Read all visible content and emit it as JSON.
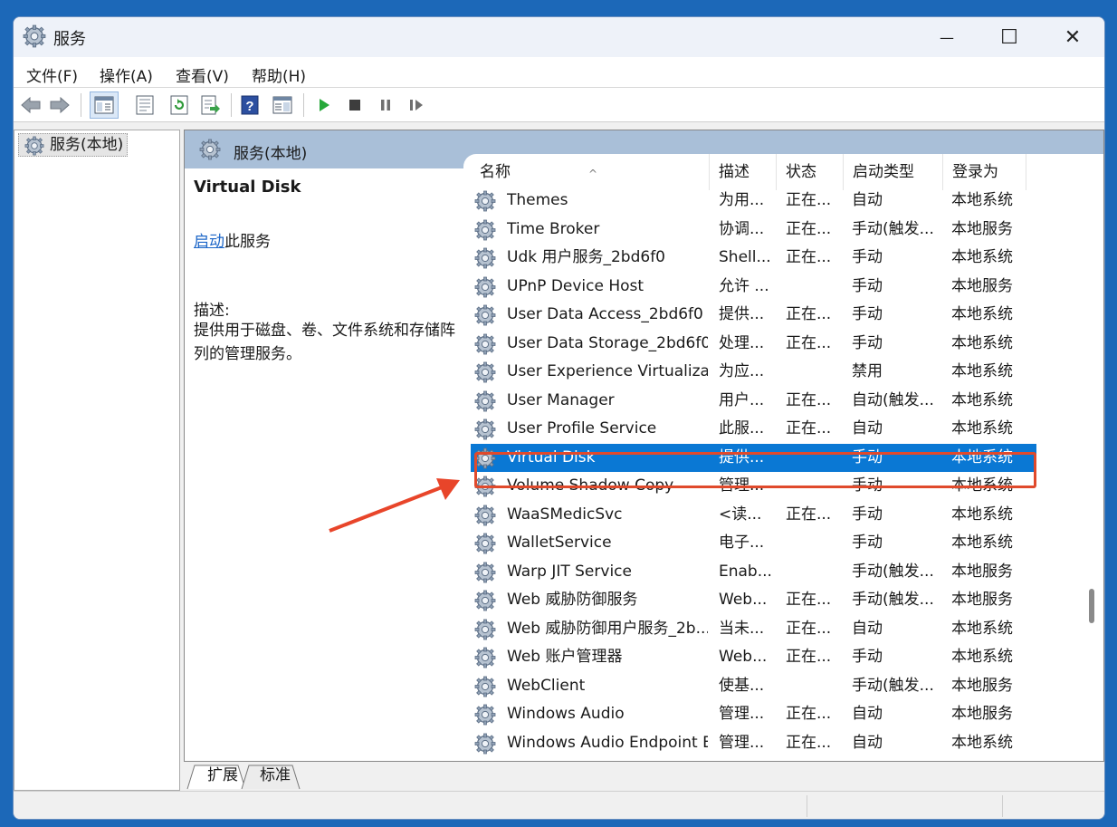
{
  "window": {
    "title": "服务",
    "minimize_glyph": "—",
    "maximize_glyph": "☐",
    "close_glyph": "✕"
  },
  "menu": {
    "items": [
      {
        "label": "文件(F)"
      },
      {
        "label": "操作(A)"
      },
      {
        "label": "查看(V)"
      },
      {
        "label": "帮助(H)"
      }
    ]
  },
  "toolbar": {
    "icons": [
      "back-arrow-icon",
      "forward-arrow-icon",
      "console-tree-icon",
      "properties-icon",
      "refresh-icon",
      "export-list-icon",
      "help-icon",
      "show-hide-icon",
      "start-service-icon",
      "stop-service-icon",
      "pause-service-icon",
      "resume-service-icon"
    ]
  },
  "tree": {
    "root_label": "服务(本地)"
  },
  "right_header": {
    "title": "服务(本地)"
  },
  "extended": {
    "service_name": "Virtual Disk",
    "start_link": "启动",
    "start_suffix": "此服务",
    "desc_label": "描述:",
    "desc_text": "提供用于磁盘、卷、文件系统和存储阵列的管理服务。"
  },
  "columns": {
    "name": "名称",
    "desc": "描述",
    "status": "状态",
    "startup": "启动类型",
    "logon": "登录为",
    "sort_glyph": "^"
  },
  "services": [
    {
      "name": "Themes",
      "desc": "为用...",
      "status": "正在...",
      "startup": "自动",
      "logon": "本地系统"
    },
    {
      "name": "Time Broker",
      "desc": "协调...",
      "status": "正在...",
      "startup": "手动(触发...",
      "logon": "本地服务"
    },
    {
      "name": "Udk 用户服务_2bd6f0",
      "desc": "Shell...",
      "status": "正在...",
      "startup": "手动",
      "logon": "本地系统"
    },
    {
      "name": "UPnP Device Host",
      "desc": "允许 ...",
      "status": "",
      "startup": "手动",
      "logon": "本地服务"
    },
    {
      "name": "User Data Access_2bd6f0",
      "desc": "提供...",
      "status": "正在...",
      "startup": "手动",
      "logon": "本地系统"
    },
    {
      "name": "User Data Storage_2bd6f0",
      "desc": "处理...",
      "status": "正在...",
      "startup": "手动",
      "logon": "本地系统"
    },
    {
      "name": "User Experience Virtualizat...",
      "desc": "为应...",
      "status": "",
      "startup": "禁用",
      "logon": "本地系统"
    },
    {
      "name": "User Manager",
      "desc": "用户...",
      "status": "正在...",
      "startup": "自动(触发...",
      "logon": "本地系统"
    },
    {
      "name": "User Profile Service",
      "desc": "此服...",
      "status": "正在...",
      "startup": "自动",
      "logon": "本地系统"
    },
    {
      "name": "Virtual Disk",
      "desc": "提供...",
      "status": "",
      "startup": "手动",
      "logon": "本地系统"
    },
    {
      "name": "Volume Shadow Copy",
      "desc": "管理...",
      "status": "",
      "startup": "手动",
      "logon": "本地系统"
    },
    {
      "name": "WaaSMedicSvc",
      "desc": "<读...",
      "status": "正在...",
      "startup": "手动",
      "logon": "本地系统"
    },
    {
      "name": "WalletService",
      "desc": "电子...",
      "status": "",
      "startup": "手动",
      "logon": "本地系统"
    },
    {
      "name": "Warp JIT Service",
      "desc": "Enab...",
      "status": "",
      "startup": "手动(触发...",
      "logon": "本地服务"
    },
    {
      "name": "Web 威胁防御服务",
      "desc": "Web...",
      "status": "正在...",
      "startup": "手动(触发...",
      "logon": "本地服务"
    },
    {
      "name": "Web 威胁防御用户服务_2b...",
      "desc": "当未...",
      "status": "正在...",
      "startup": "自动",
      "logon": "本地系统"
    },
    {
      "name": "Web 账户管理器",
      "desc": "Web...",
      "status": "正在...",
      "startup": "手动",
      "logon": "本地系统"
    },
    {
      "name": "WebClient",
      "desc": "使基...",
      "status": "",
      "startup": "手动(触发...",
      "logon": "本地服务"
    },
    {
      "name": "Windows Audio",
      "desc": "管理...",
      "status": "正在...",
      "startup": "自动",
      "logon": "本地服务"
    },
    {
      "name": "Windows Audio Endpoint B...",
      "desc": "管理...",
      "status": "正在...",
      "startup": "自动",
      "logon": "本地系统"
    }
  ],
  "selected_service": "Virtual Disk",
  "tabs": [
    {
      "label": "扩展"
    },
    {
      "label": "标准"
    }
  ],
  "colors": {
    "selection": "#0a78d4",
    "highlight_box": "#e04a2c",
    "arrow": "#e8452a",
    "link": "#1e67c8"
  }
}
